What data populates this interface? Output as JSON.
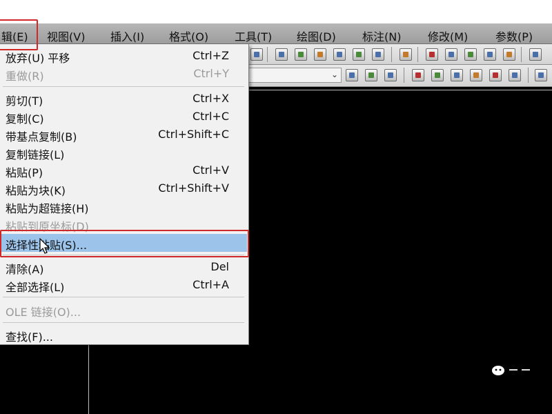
{
  "menubar": {
    "items": [
      {
        "label": "辑(E)"
      },
      {
        "label": "视图(V)"
      },
      {
        "label": "插入(I)"
      },
      {
        "label": "格式(O)"
      },
      {
        "label": "工具(T)"
      },
      {
        "label": "绘图(D)"
      },
      {
        "label": "标注(N)"
      },
      {
        "label": "修改(M)"
      },
      {
        "label": "参数(P)"
      }
    ]
  },
  "edit_menu": {
    "items": [
      {
        "label": "放弃(U) 平移",
        "shortcut": "Ctrl+Z",
        "enabled": true
      },
      {
        "label": "重做(R)",
        "shortcut": "Ctrl+Y",
        "enabled": false
      },
      {
        "label": "剪切(T)",
        "shortcut": "Ctrl+X",
        "enabled": true
      },
      {
        "label": "复制(C)",
        "shortcut": "Ctrl+C",
        "enabled": true
      },
      {
        "label": "带基点复制(B)",
        "shortcut": "Ctrl+Shift+C",
        "enabled": true
      },
      {
        "label": "复制链接(L)",
        "shortcut": "",
        "enabled": true
      },
      {
        "label": "粘贴(P)",
        "shortcut": "Ctrl+V",
        "enabled": true
      },
      {
        "label": "粘贴为块(K)",
        "shortcut": "Ctrl+Shift+V",
        "enabled": true
      },
      {
        "label": "粘贴为超链接(H)",
        "shortcut": "",
        "enabled": true
      },
      {
        "label": "粘贴到原坐标(D)",
        "shortcut": "",
        "enabled": false
      },
      {
        "label": "选择性粘贴(S)...",
        "shortcut": "",
        "enabled": true,
        "selected": true
      },
      {
        "label": "清除(A)",
        "shortcut": "Del",
        "enabled": true
      },
      {
        "label": "全部选择(L)",
        "shortcut": "Ctrl+A",
        "enabled": true
      },
      {
        "label": "OLE 链接(O)...",
        "shortcut": "",
        "enabled": false
      },
      {
        "label": "查找(F)...",
        "shortcut": "",
        "enabled": true
      }
    ]
  },
  "colors": {
    "highlight_box": "#d02828",
    "selected_row": "#9cc3ea",
    "menubar": "#a9a9a9",
    "canvas": "#000000"
  }
}
